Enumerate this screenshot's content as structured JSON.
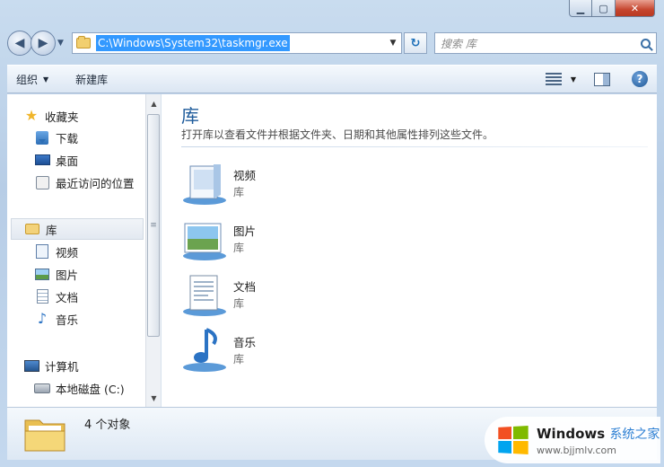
{
  "window": {
    "caption_minimize": "▁",
    "caption_maximize": "▢",
    "caption_close": "✕"
  },
  "address_bar": {
    "path": "C:\\Windows\\System32\\taskmgr.exe",
    "search_placeholder": "搜索 库"
  },
  "toolbar": {
    "organize_label": "组织",
    "new_library_label": "新建库"
  },
  "nav": {
    "favorites": {
      "label": "收藏夹",
      "items": [
        {
          "label": "下载",
          "icon": "download-icon"
        },
        {
          "label": "桌面",
          "icon": "desktop-icon"
        },
        {
          "label": "最近访问的位置",
          "icon": "recent-places-icon"
        }
      ]
    },
    "libraries": {
      "label": "库",
      "items": [
        {
          "label": "视频",
          "icon": "video-icon"
        },
        {
          "label": "图片",
          "icon": "picture-icon"
        },
        {
          "label": "文档",
          "icon": "document-icon"
        },
        {
          "label": "音乐",
          "icon": "music-icon"
        }
      ]
    },
    "computer": {
      "label": "计算机",
      "items": [
        {
          "label": "本地磁盘 (C:)",
          "icon": "disk-icon"
        }
      ]
    }
  },
  "content": {
    "title": "库",
    "description": "打开库以查看文件并根据文件夹、日期和其他属性排列这些文件。",
    "libraries": [
      {
        "name": "视频",
        "type": "库",
        "icon": "video-library-icon"
      },
      {
        "name": "图片",
        "type": "库",
        "icon": "picture-library-icon"
      },
      {
        "name": "文档",
        "type": "库",
        "icon": "document-library-icon"
      },
      {
        "name": "音乐",
        "type": "库",
        "icon": "music-library-icon"
      }
    ]
  },
  "status": {
    "count_text": "4 个对象"
  },
  "watermark": {
    "brand": "Windows",
    "brand_suffix": "系统之家",
    "url": "www.bjjmlv.com"
  },
  "colors": {
    "accent": "#1e5b9b",
    "selection": "#3399ff",
    "frame": "#b7cde6"
  }
}
